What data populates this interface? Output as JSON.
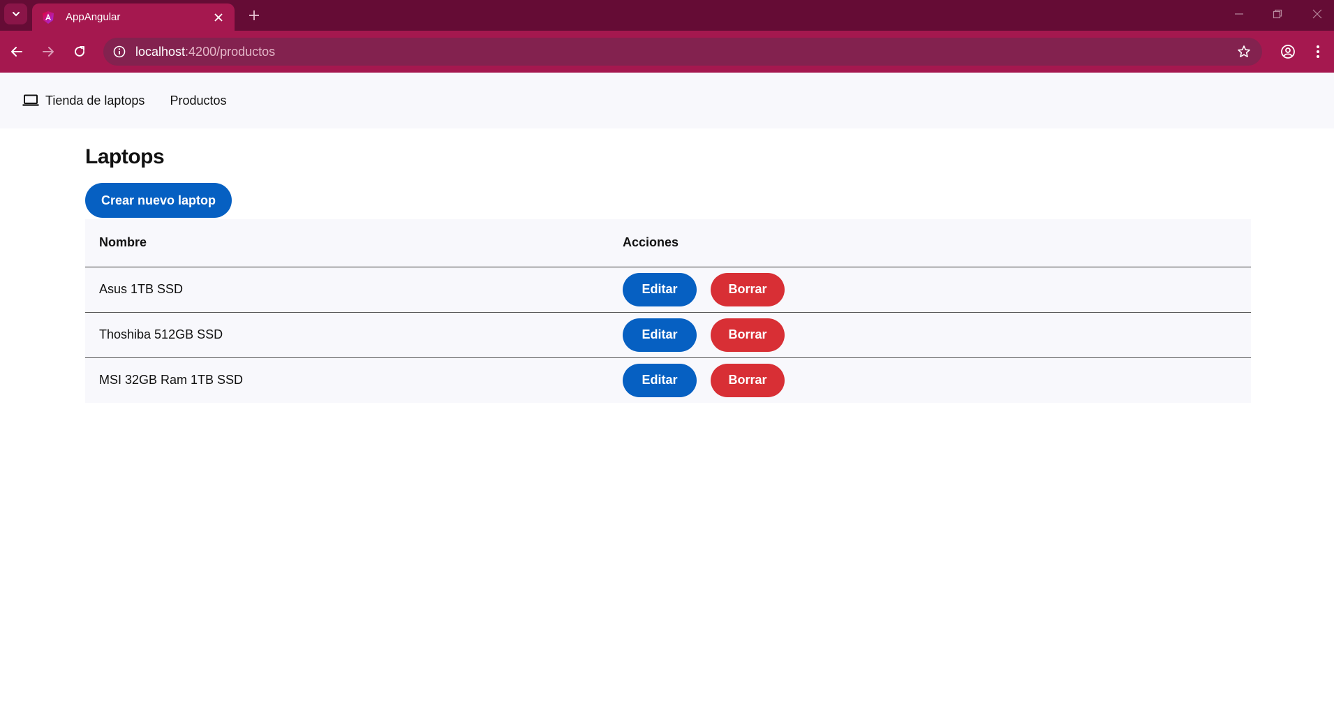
{
  "browser": {
    "tab_title": "AppAngular",
    "url_host": "localhost",
    "url_rest": ":4200/productos",
    "colors": {
      "tabstrip": "#650c35",
      "toolbar": "#a5184f",
      "omnibox": "#83224f"
    }
  },
  "navbar": {
    "brand": "Tienda de laptops",
    "brand_icon": "laptop-icon",
    "links": [
      {
        "label": "Productos"
      }
    ]
  },
  "page": {
    "title": "Laptops",
    "create_button": "Crear nuevo laptop"
  },
  "table": {
    "headers": [
      "Nombre",
      "Acciones"
    ],
    "rows": [
      {
        "name": "Asus 1TB SSD",
        "edit": "Editar",
        "delete": "Borrar"
      },
      {
        "name": "Thoshiba 512GB SSD",
        "edit": "Editar",
        "delete": "Borrar"
      },
      {
        "name": "MSI 32GB Ram 1TB SSD",
        "edit": "Editar",
        "delete": "Borrar"
      }
    ]
  },
  "colors": {
    "primary": "#0660c2",
    "danger": "#d82f35",
    "navbar_bg": "#f8f8fc"
  }
}
